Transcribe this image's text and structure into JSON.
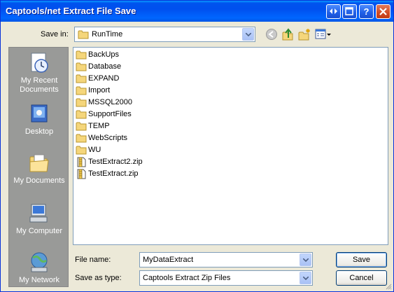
{
  "window": {
    "title": "Captools/net Extract File Save",
    "buttons": [
      "swap-icon",
      "maximize-icon",
      "help-icon",
      "close-icon"
    ],
    "help_label": "?"
  },
  "save_in": {
    "label": "Save in:",
    "value": "RunTime"
  },
  "toolbar": {
    "icons": [
      "back-icon",
      "up-folder-icon",
      "new-folder-icon",
      "views-menu-icon"
    ]
  },
  "places": [
    {
      "label_line1": "My Recent",
      "label_line2": "Documents",
      "icon": "recent-documents-icon"
    },
    {
      "label_line1": "Desktop",
      "label_line2": "",
      "icon": "desktop-icon"
    },
    {
      "label_line1": "My Documents",
      "label_line2": "",
      "icon": "my-documents-icon"
    },
    {
      "label_line1": "My Computer",
      "label_line2": "",
      "icon": "my-computer-icon"
    },
    {
      "label_line1": "My Network",
      "label_line2": "",
      "icon": "my-network-icon"
    }
  ],
  "files": [
    {
      "name": "BackUps",
      "type": "folder"
    },
    {
      "name": "Database",
      "type": "folder"
    },
    {
      "name": "EXPAND",
      "type": "folder"
    },
    {
      "name": "Import",
      "type": "folder"
    },
    {
      "name": "MSSQL2000",
      "type": "folder"
    },
    {
      "name": "SupportFiles",
      "type": "folder"
    },
    {
      "name": "TEMP",
      "type": "folder"
    },
    {
      "name": "WebScripts",
      "type": "folder"
    },
    {
      "name": "WU",
      "type": "folder"
    },
    {
      "name": "TestExtract2.zip",
      "type": "zip"
    },
    {
      "name": "TestExtract.zip",
      "type": "zip"
    }
  ],
  "file_name": {
    "label": "File name:",
    "value": "MyDataExtract"
  },
  "save_as_type": {
    "label": "Save as type:",
    "value": "Captools Extract Zip Files"
  },
  "actions": {
    "save": "Save",
    "cancel": "Cancel"
  },
  "colors": {
    "titlebar": "#0054e3",
    "window_bg": "#ece9d8",
    "places_bg": "#999a98"
  }
}
